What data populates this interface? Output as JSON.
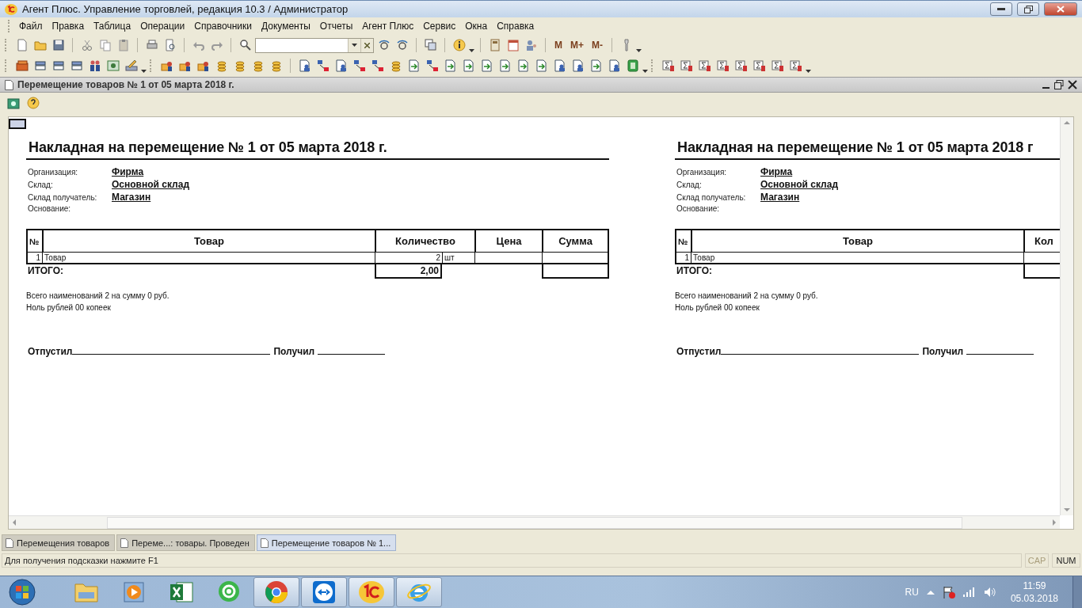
{
  "window": {
    "title": "Агент Плюс. Управление торговлей, редакция 10.3 / Администратор"
  },
  "menu": [
    {
      "label": "Файл"
    },
    {
      "label": "Правка"
    },
    {
      "label": "Таблица"
    },
    {
      "label": "Операции"
    },
    {
      "label": "Справочники"
    },
    {
      "label": "Документы"
    },
    {
      "label": "Отчеты"
    },
    {
      "label": "Агент Плюс"
    },
    {
      "label": "Сервис"
    },
    {
      "label": "Окна"
    },
    {
      "label": "Справка"
    }
  ],
  "memory_buttons": [
    "M",
    "M+",
    "M-"
  ],
  "document_window": {
    "title": "Перемещение товаров № 1 от 05 марта 2018 г."
  },
  "copies": [
    {
      "title": "Накладная на перемещение № 1 от 05 марта 2018 г.",
      "fields": [
        {
          "label": "Организация:",
          "value": "Фирма"
        },
        {
          "label": "Склад:",
          "value": "Основной склад"
        },
        {
          "label": "Склад получатель:",
          "value": "Магазин"
        },
        {
          "label": "Основание:"
        }
      ],
      "columns": [
        "№",
        "Товар",
        "Количество",
        "Цена",
        "Сумма"
      ],
      "rows": [
        {
          "number": "1",
          "name": "Товар",
          "quantity": "2",
          "unit": "шт"
        }
      ],
      "total": {
        "label": "ИТОГО:",
        "quantity": "2,00"
      },
      "summary": [
        "Всего наименований 2 на сумму 0 руб.",
        "Ноль рублей 00 копеек"
      ],
      "signatures": [
        "Отпустил",
        "Получил"
      ]
    },
    {
      "title": "Накладная на перемещение № 1 от 05 марта 2018 г",
      "fields": [
        {
          "label": "Организация:",
          "value": "Фирма"
        },
        {
          "label": "Склад:",
          "value": "Основной склад"
        },
        {
          "label": "Склад получатель:",
          "value": "Магазин"
        },
        {
          "label": "Основание:"
        }
      ],
      "columns": [
        "№",
        "Товар",
        "Кол"
      ],
      "rows": [
        {
          "number": "1",
          "name": "Товар"
        }
      ],
      "total": {
        "label": "ИТОГО:"
      },
      "summary": [
        "Всего наименований 2 на сумму 0 руб.",
        "Ноль рублей 00 копеек"
      ],
      "signatures": [
        "Отпустил",
        "Получил"
      ]
    }
  ],
  "window_tabs": [
    {
      "label": "Перемещения товаров",
      "selected": false
    },
    {
      "label": "Переме...: товары. Проведен",
      "selected": false
    },
    {
      "label": "Перемещение товаров № 1...",
      "selected": true
    }
  ],
  "status_bar": {
    "hint": "Для получения подсказки нажмите F1",
    "indicators": [
      {
        "label": "CAP",
        "on": false
      },
      {
        "label": "NUM",
        "on": true
      }
    ]
  },
  "taskbar": {
    "apps": [
      {
        "kind": "folder",
        "running": false
      },
      {
        "kind": "player",
        "running": false
      },
      {
        "kind": "spreadsheet",
        "running": false
      },
      {
        "kind": "mail",
        "running": false
      },
      {
        "kind": "browser",
        "running": true
      },
      {
        "kind": "remote",
        "running": true
      },
      {
        "kind": "onec",
        "running": true
      },
      {
        "kind": "ie",
        "running": true
      }
    ],
    "language": "RU",
    "time": "11:59",
    "date": "05.03.2018"
  }
}
